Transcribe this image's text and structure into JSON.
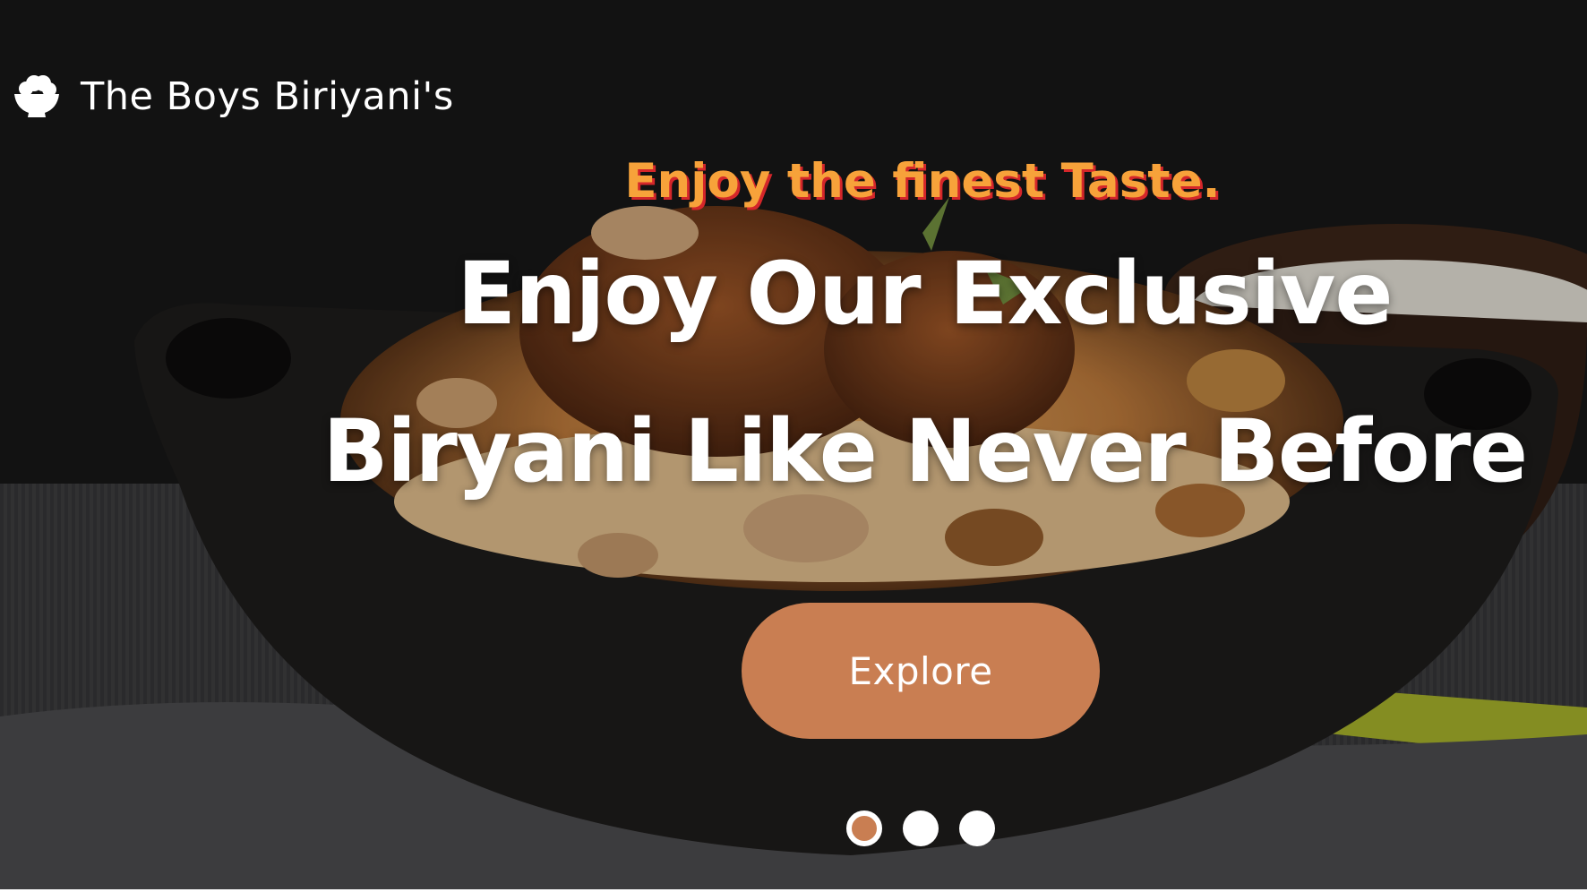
{
  "brand": {
    "name": "The Boys Biriyani's",
    "icon": "rice-bowl-icon"
  },
  "hero": {
    "tagline": "Enjoy the finest Taste.",
    "headline_line1": "Enjoy Our Exclusive",
    "headline_line2": "Biryani Like Never Before",
    "cta_label": "Explore",
    "background_image": "biryani-bowl-photo"
  },
  "carousel": {
    "slide_count": 3,
    "active_index": 0
  },
  "colors": {
    "accent": "#c97e52",
    "tagline": "#f7a23a",
    "tagline_shadow": "#d4262a",
    "text": "#ffffff"
  }
}
